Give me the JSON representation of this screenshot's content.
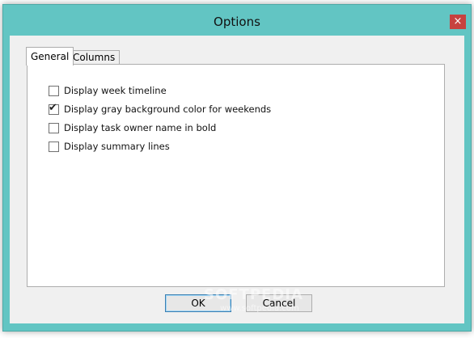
{
  "window": {
    "title": "Options",
    "close_glyph": "×"
  },
  "tabs": [
    {
      "label": "General",
      "active": true
    },
    {
      "label": "Columns",
      "active": false
    }
  ],
  "options": [
    {
      "label": "Display week timeline",
      "checked": false
    },
    {
      "label": "Display gray background color for weekends",
      "checked": true
    },
    {
      "label": "Display task owner name in bold",
      "checked": false
    },
    {
      "label": "Display summary lines",
      "checked": false
    }
  ],
  "buttons": {
    "ok_label": "OK",
    "cancel_label": "Cancel"
  },
  "watermark": {
    "text": "SOFTPEDIA",
    "url": "www.softpedia.com"
  },
  "colors": {
    "frame": "#62c5c3",
    "close": "#c7423f"
  }
}
